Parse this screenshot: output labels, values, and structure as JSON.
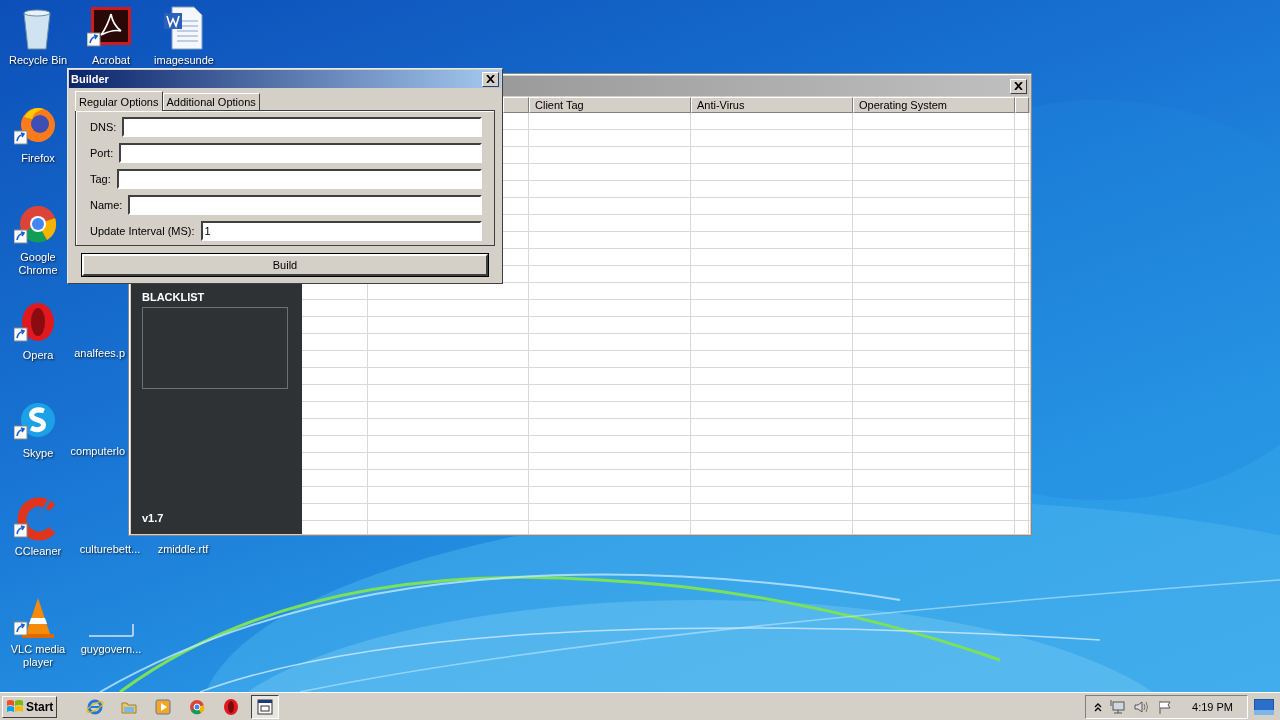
{
  "desktop_icons": [
    {
      "label": "Recycle Bin",
      "kind": "bin"
    },
    {
      "label": "Firefox",
      "kind": "firefox",
      "shortcut": true
    },
    {
      "label": "Google Chrome",
      "kind": "chrome",
      "shortcut": true
    },
    {
      "label": "Opera",
      "kind": "opera",
      "shortcut": true
    },
    {
      "label": "Skype",
      "kind": "skype",
      "shortcut": true
    },
    {
      "label": "CCleaner",
      "kind": "ccleaner",
      "shortcut": true
    },
    {
      "label": "VLC media player",
      "kind": "vlc",
      "shortcut": true
    },
    {
      "label": "Acrobat",
      "kind": "acrobat",
      "shortcut": true
    },
    {
      "label": "analfees.p",
      "kind": "hidden"
    },
    {
      "label": "computerlo",
      "kind": "hidden"
    },
    {
      "label": "culturebett...",
      "kind": "under"
    },
    {
      "label": "guygovern...",
      "kind": "blank"
    },
    {
      "label": "imagesunde",
      "kind": "word"
    },
    {
      "label": "zmiddle.rtf",
      "kind": "under"
    }
  ],
  "main_window": {
    "columns": [
      "Client Tag",
      "Anti-Virus",
      "Operating System"
    ],
    "sidebar": {
      "heading": "BLACKLIST",
      "version": "v1.7"
    }
  },
  "builder": {
    "title": "Builder",
    "tabs": [
      {
        "label": "Regular Options",
        "selected": true
      },
      {
        "label": "Additional Options",
        "selected": false
      }
    ],
    "fields": [
      {
        "label": "DNS:"
      },
      {
        "label": "Port:"
      },
      {
        "label": "Tag:"
      },
      {
        "label": "Name:"
      },
      {
        "label": "Update Interval (MS):",
        "value": "1"
      }
    ],
    "button": "Build"
  },
  "taskbar": {
    "start": "Start",
    "apps": [
      {
        "kind": "ie",
        "active": false
      },
      {
        "kind": "folder",
        "active": false
      },
      {
        "kind": "media",
        "active": false
      },
      {
        "kind": "chrome",
        "active": false
      },
      {
        "kind": "opera",
        "active": false
      },
      {
        "kind": "app",
        "active": true
      }
    ],
    "clock": "4:19 PM"
  }
}
